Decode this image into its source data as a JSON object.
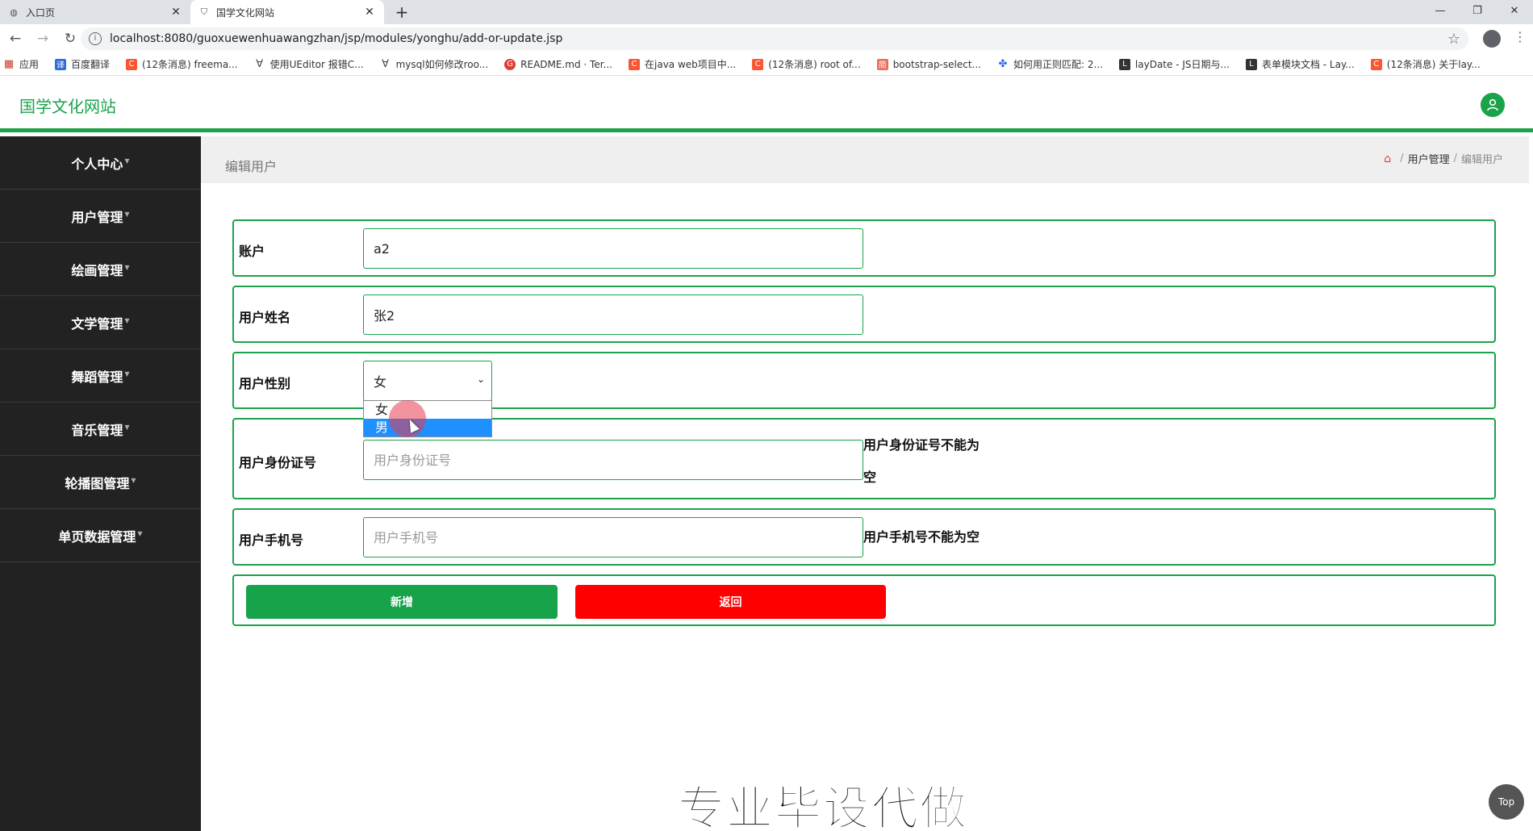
{
  "browser": {
    "tabs": [
      {
        "title": "入口页",
        "active": false
      },
      {
        "title": "国学文化网站",
        "active": true
      }
    ],
    "new_tab": "+",
    "url": "localhost:8080/guoxuewenhuawangzhan/jsp/modules/yonghu/add-or-update.jsp",
    "bookmarks": [
      {
        "label": "应用",
        "icon": "apps-grid-icon"
      },
      {
        "label": "百度翻译",
        "icon": "baidu-translate-icon"
      },
      {
        "label": "(12条消息) freema...",
        "icon": "csdn-icon"
      },
      {
        "label": "使用UEditor 报错C...",
        "icon": "vue-icon"
      },
      {
        "label": "mysql如何修改roo...",
        "icon": "vue-icon"
      },
      {
        "label": "README.md · Ter...",
        "icon": "gitee-icon"
      },
      {
        "label": "在java web项目中...",
        "icon": "csdn-icon"
      },
      {
        "label": "(12条消息) root of...",
        "icon": "csdn-icon"
      },
      {
        "label": "bootstrap-select...",
        "icon": "jianshu-icon"
      },
      {
        "label": "如何用正则匹配: 2...",
        "icon": "baidu-paw-icon"
      },
      {
        "label": "layDate - JS日期与...",
        "icon": "layui-icon"
      },
      {
        "label": "表单模块文档 - Lay...",
        "icon": "layui-icon"
      },
      {
        "label": "(12条消息) 关于lay...",
        "icon": "csdn-icon"
      }
    ]
  },
  "app": {
    "title": "国学文化网站"
  },
  "sidebar": {
    "items": [
      {
        "label": "个人中心"
      },
      {
        "label": "用户管理"
      },
      {
        "label": "绘画管理"
      },
      {
        "label": "文学管理"
      },
      {
        "label": "舞蹈管理"
      },
      {
        "label": "音乐管理"
      },
      {
        "label": "轮播图管理"
      },
      {
        "label": "单页数据管理"
      }
    ]
  },
  "header": {
    "page_title": "编辑用户",
    "breadcrumb": [
      "用户管理",
      "编辑用户"
    ]
  },
  "form": {
    "account": {
      "label": "账户",
      "value": "a2"
    },
    "name": {
      "label": "用户姓名",
      "value": "张2"
    },
    "gender": {
      "label": "用户性别",
      "value": "女",
      "options": [
        "女",
        "男"
      ],
      "highlighted": "男"
    },
    "id_card": {
      "label": "用户身份证号",
      "placeholder": "用户身份证号",
      "error": "用户身份证号不能为空"
    },
    "phone": {
      "label": "用户手机号",
      "placeholder": "用户手机号",
      "error": "用户手机号不能为空"
    },
    "add_button": "新增",
    "back_button": "返回"
  },
  "watermark": "专业毕设代做",
  "top_button": "Top",
  "colors": {
    "accent": "#1aa34a",
    "sidebar_bg": "#222222",
    "danger": "#ff0000",
    "highlight": "#1e90ff"
  }
}
